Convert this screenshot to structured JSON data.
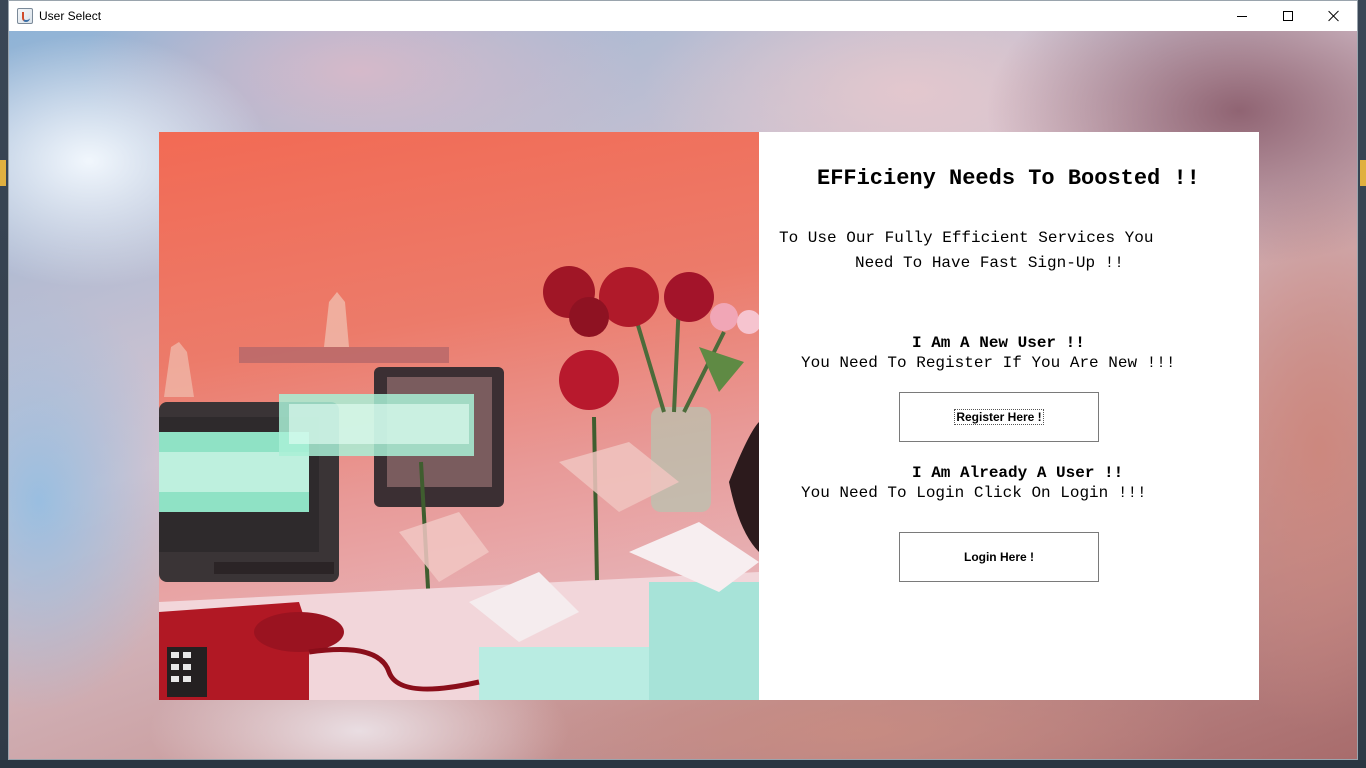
{
  "window": {
    "title": "User Select",
    "icon": "java-app-icon",
    "controls": [
      "minimize-icon",
      "maximize-icon",
      "close-icon"
    ]
  },
  "card": {
    "headline": "EFFicieny Needs To Boosted !!",
    "subtitle_line1": "To Use Our Fully Efficient Services You",
    "subtitle_line2": "Need To Have Fast Sign-Up !!",
    "new_user": {
      "title": "I Am A New User !!",
      "description": "You Need To Register If You Are New !!!",
      "button_label": "Register Here !"
    },
    "existing_user": {
      "title": "I Am Already A User !!",
      "description": "You Need To Login Click On Login !!!",
      "button_label": "Login Here !"
    }
  },
  "colors": {
    "card_background": "#ffffff",
    "photo_tone": "#f26a54",
    "text": "#000000"
  }
}
